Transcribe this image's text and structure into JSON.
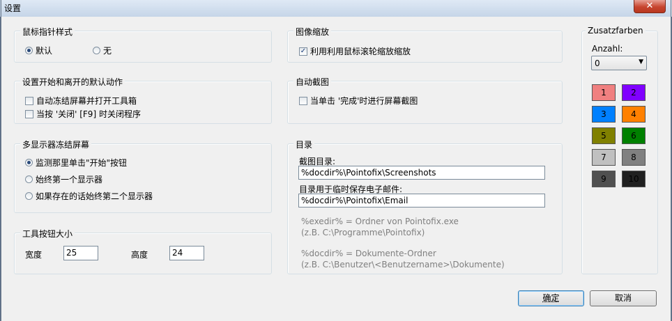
{
  "window": {
    "title": "设置",
    "close_glyph": "✕"
  },
  "pointer": {
    "title": "鼠标指针样式",
    "opt_default": "默认",
    "opt_none": "无"
  },
  "zoom": {
    "title": "图像缩放",
    "wheel_label": "利用利用鼠标滚轮缩放缩放"
  },
  "startstop": {
    "title": "设置开始和离开的默认动作",
    "freeze_label": "自动冻结屏幕并打开工具箱",
    "close_label": "当按 '关闭' [F9] 时关闭程序"
  },
  "autoshot": {
    "title": "自动截图",
    "label": "当单击 '完成'时进行屏幕截图"
  },
  "multimonitor": {
    "title": "多显示器冻结屏幕",
    "opt1": "监测那里单击\"开始\"按钮",
    "opt2": "始终第一个显示器",
    "opt3": "如果存在的话始终第二个显示器"
  },
  "directory": {
    "title": "目录",
    "screenshots_label": "截图目录:",
    "screenshots_value": "%docdir%\\Pointofix\\Screenshots",
    "email_label": "目录用于临时保存电子邮件:",
    "email_value": "%docdir%\\Pointofix\\Email",
    "hint1": "%exedir% = Ordner von Pointofix.exe",
    "hint2": "(z.B. C:\\Programme\\Pointofix)",
    "hint3": "%docdir% = Dokumente-Ordner",
    "hint4": "(z.B. C:\\Benutzer\\<Benutzername>\\Dokumente)"
  },
  "toolbutton": {
    "title": "工具按钮大小",
    "width_label": "宽度",
    "width_value": "25",
    "height_label": "高度",
    "height_value": "24"
  },
  "extra_colors": {
    "title": "Zusatzfarben",
    "count_label": "Anzahl:",
    "count_value": "0",
    "swatches": [
      {
        "label": "1",
        "color": "#f08080"
      },
      {
        "label": "2",
        "color": "#8000ff"
      },
      {
        "label": "3",
        "color": "#0080ff"
      },
      {
        "label": "4",
        "color": "#ff8000"
      },
      {
        "label": "5",
        "color": "#808000"
      },
      {
        "label": "6",
        "color": "#008000"
      },
      {
        "label": "7",
        "color": "#c0c0c0"
      },
      {
        "label": "8",
        "color": "#808080"
      },
      {
        "label": "9",
        "color": "#505050"
      },
      {
        "label": "10",
        "color": "#202020"
      }
    ]
  },
  "buttons": {
    "ok": "确定",
    "cancel": "取消"
  }
}
